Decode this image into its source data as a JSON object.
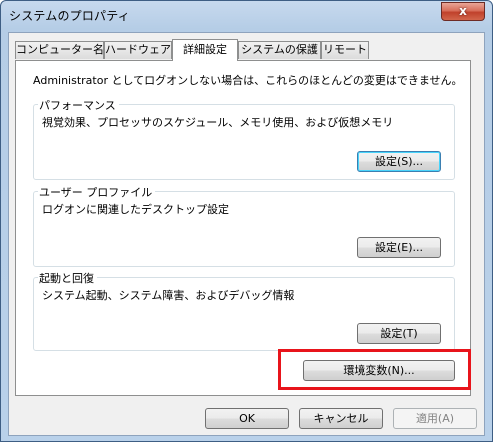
{
  "window": {
    "title": "システムのプロパティ",
    "close_symbol": "x"
  },
  "tabs": [
    {
      "label": "コンピューター名"
    },
    {
      "label": "ハードウェア"
    },
    {
      "label": "詳細設定"
    },
    {
      "label": "システムの保護"
    },
    {
      "label": "リモート"
    }
  ],
  "active_tab": "詳細設定",
  "intro": "Administrator としてログオンしない場合は、これらのほとんどの変更はできません。",
  "performance": {
    "title": "パフォーマンス",
    "description": "視覚効果、プロセッサのスケジュール、メモリ使用、および仮想メモリ",
    "button": "設定(S)..."
  },
  "user_profile": {
    "title": "ユーザー プロファイル",
    "description": "ログオンに関連したデスクトップ設定",
    "button": "設定(E)..."
  },
  "startup_recovery": {
    "title": "起動と回復",
    "description": "システム起動、システム障害、およびデバッグ情報",
    "button": "設定(T)"
  },
  "env_button": "環境変数(N)...",
  "footer": {
    "ok": "OK",
    "cancel": "キャンセル",
    "apply": "適用(A)"
  },
  "colors": {
    "highlight": "#e8141b",
    "title_bg": "#b9d1ea",
    "close_button": "#c0412b"
  }
}
